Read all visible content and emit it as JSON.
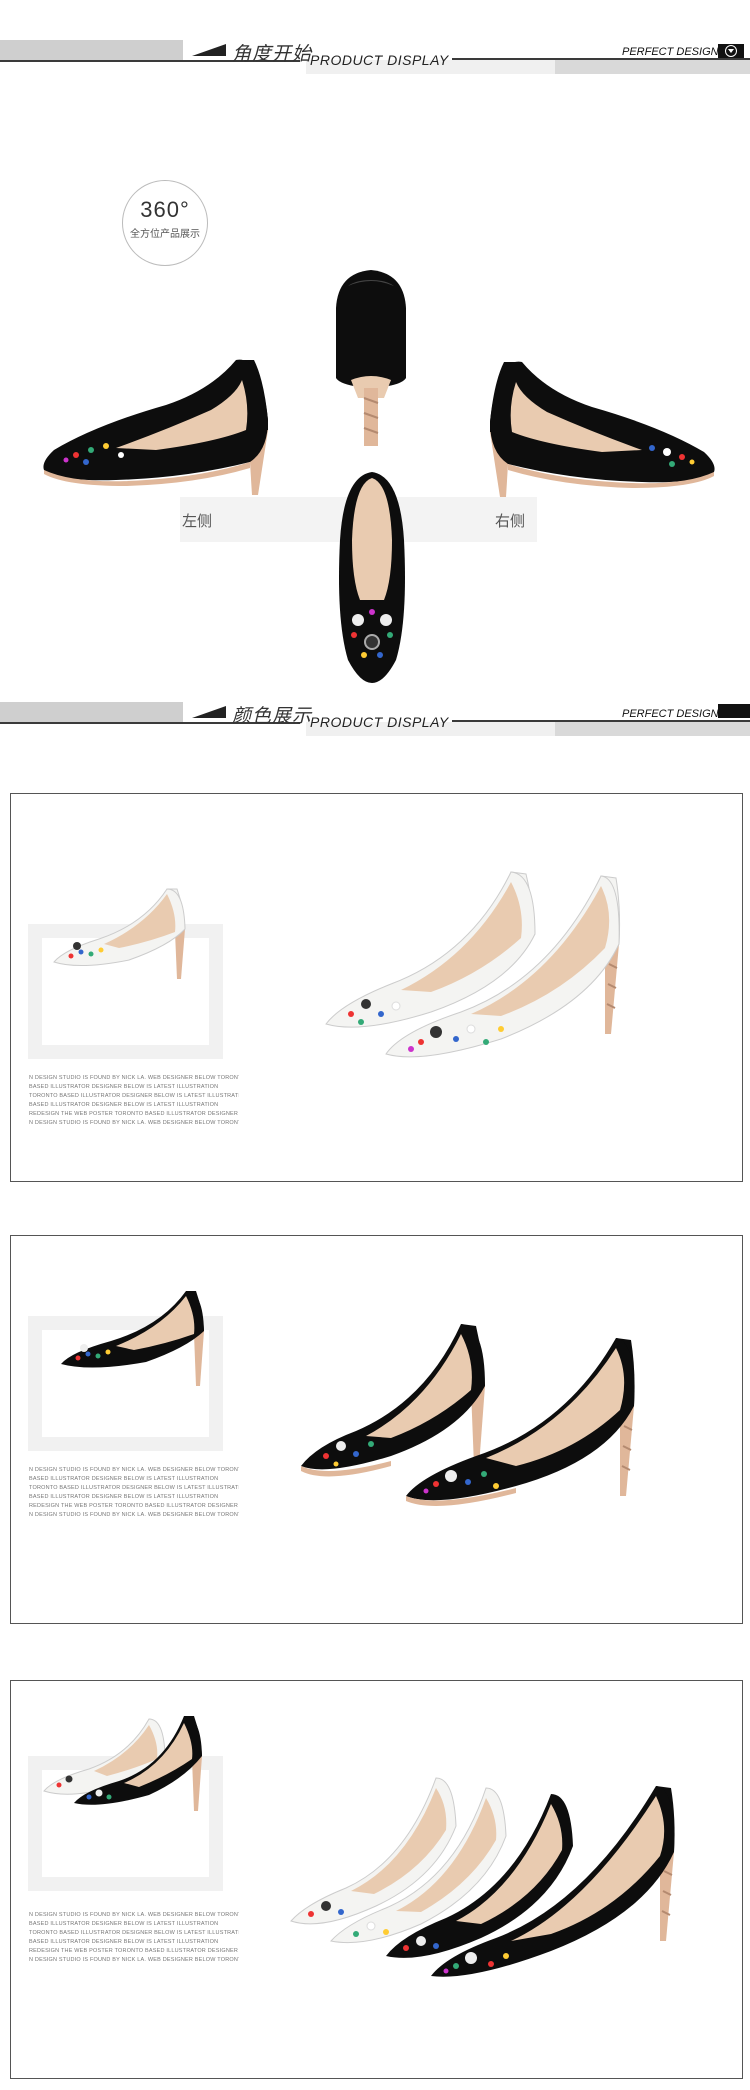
{
  "sections": {
    "angle": {
      "cn_title": "角度开始",
      "en_title": "PRODUCT DISPLAY",
      "right_label": "PERFECT DESIGN"
    },
    "color": {
      "cn_title": "颜色展示",
      "en_title": "PRODUCT DISPLAY",
      "right_label": "PERFECT DESIGN"
    }
  },
  "badge360": {
    "number": "360°",
    "caption": "全方位产品展示"
  },
  "views": {
    "left": "左侧",
    "right": "右侧"
  },
  "blurb_lines": [
    "N DESIGN STUDIO IS FOUND BY NICK LA. WEB DESIGNER BELOW TORONTO",
    "BASED ILLUSTRATOR DESIGNER BELOW IS LATEST ILLUSTRATION",
    "TORONTO BASED ILLUSTRATOR DESIGNER BELOW IS LATEST ILLUSTRATION",
    "BASED ILLUSTRATOR DESIGNER BELOW IS LATEST ILLUSTRATION",
    "REDESIGN THE WEB POSTER TORONTO BASED ILLUSTRATOR DESIGNER",
    "N DESIGN STUDIO IS FOUND BY NICK LA. WEB DESIGNER BELOW TORONTO"
  ],
  "colors": {
    "black_shoe": "#0d0d0d",
    "white_shoe": "#f4f4f2",
    "lining": "#e9cbb0",
    "heel": "#e0b79a",
    "frame_border": "#555555"
  }
}
